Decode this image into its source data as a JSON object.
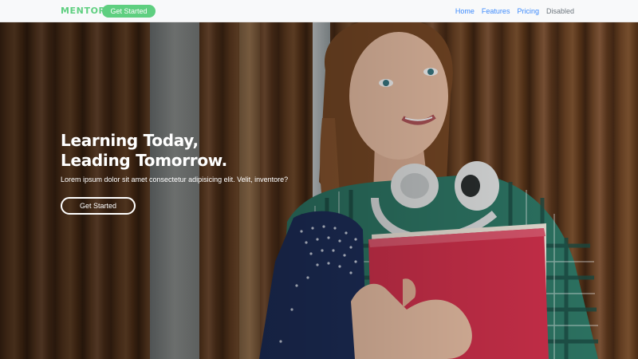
{
  "navbar": {
    "brand": "MENTOR",
    "cta_label": "Get Started",
    "links": [
      "Home",
      "Features",
      "Pricing",
      "Disabled"
    ]
  },
  "hero": {
    "title_line1": "Learning Today,",
    "title_line2": "Leading Tomorrow.",
    "subtitle": "Lorem ipsum dolor sit amet consectetur adipisicing elit. Velit, inventore?",
    "button_label": "Get Started"
  },
  "colors": {
    "accent": "#5fcf80",
    "nav_background": "#f8f9fa",
    "link": "#0d6efd",
    "link_disabled": "#6c757d"
  },
  "icons": [
    "headphones-icon",
    "book-icon"
  ]
}
